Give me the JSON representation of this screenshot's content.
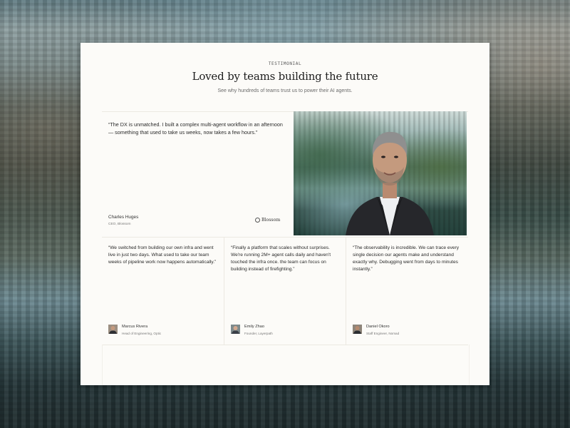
{
  "header": {
    "eyebrow": "TESTIMONIAL",
    "title": "Loved by teams building the future",
    "subtitle": "See why hundreds of teams trust us to power their AI agents."
  },
  "featured": {
    "quote": "“The DX is unmatched. I built a complex multi-agent workflow in an afternoon — something that used to take us weeks, now takes a few hours.”",
    "name": "Charles Huges",
    "role": "CEO, Blossom",
    "company_logo": "Blossom",
    "logo_icon": "blossom-logo-icon"
  },
  "testimonials": [
    {
      "quote": "“We switched from building our own infra and went live in just two days. What used to take our team weeks of pipeline work now happens automatically.”",
      "name": "Marcus Rivera",
      "role": "Head of Engineering, Optic"
    },
    {
      "quote": "“Finally a platform that scales without surprises. We're running 2M+ agent calls daily and haven't touched the infra once. the team can focus on building instead of firefighting.”",
      "name": "Emily Zhao",
      "role": "Founder, Layerpath"
    },
    {
      "quote": "“The observability is incredible. We can trace every single decision our agents make and understand exactly why. Debugging went from days to minutes instantly.”",
      "name": "Daniel Okoro",
      "role": "Staff Engineer, Nomad"
    }
  ],
  "colors": {
    "card_background": "#fcfbf8",
    "text_primary": "#1d1d1d",
    "text_muted": "#6b6b6b",
    "divider": "#ece9e2"
  }
}
